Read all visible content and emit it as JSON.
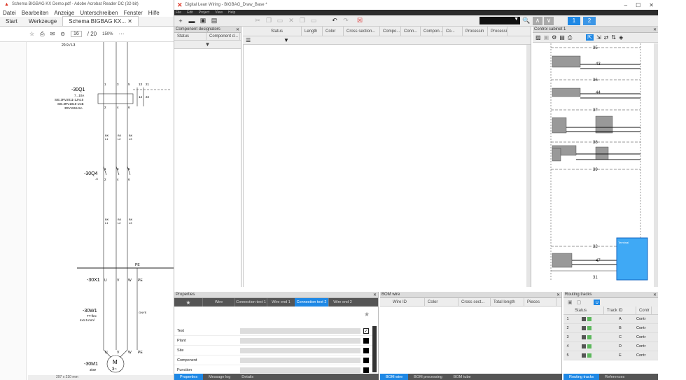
{
  "acrobat": {
    "title": "Schema BIGBAG KX Demo.pdf - Adobe Acrobat Reader DC (32-bit)",
    "menu": [
      "Datei",
      "Bearbeiten",
      "Anzeige",
      "Unterschreiben",
      "Fenster",
      "Hilfe"
    ],
    "tabs": [
      "Start",
      "Werkzeuge",
      "Schema BIGBAG KX..."
    ],
    "page_current": "16",
    "page_total": "/ 20",
    "zoom": "150%",
    "page_size": "297 x 210 mm",
    "schematic": {
      "top_ref": "20.9 / L3",
      "q1_tag": "-30Q1",
      "q1_range": "7...10A",
      "q1_order1": "SIE.3RV2011-1JA15",
      "q1_order2": "SIE.3RV1915-1CB",
      "q1_order3": "3RV1915-5A",
      "q1_pins_top": [
        "1",
        "3",
        "5",
        "13",
        "21"
      ],
      "q1_pins_bot": [
        "2",
        "4",
        "6",
        "14",
        "22"
      ],
      "wire_label": "BK",
      "wire_l1": "L1",
      "wire_l2": "L2",
      "wire_l3": "L3",
      "q4_tag": "-30Q4",
      "q4_sub": ".4",
      "q4_pins_top": [
        "1",
        "3",
        "5"
      ],
      "q4_pins_bot": [
        "2",
        "4",
        "6"
      ],
      "pe": "PE",
      "x1_tag": "-30X1",
      "x1_pins": [
        "U",
        "V",
        "W",
        "PE"
      ],
      "w1_tag": "-30W1",
      "w1_type": "TT-flex",
      "w1_size": "4x1.5 mm²",
      "w1_shield": "GNYE",
      "m1_tag": "-30M1",
      "m1_power": "3kW",
      "m1_letter": "M",
      "m1_phase": "3~",
      "m1_pins": [
        "U",
        "V",
        "W",
        "PE"
      ]
    }
  },
  "dlw": {
    "title": "Digital Lean Wiring - BIGBAG_Draw_Base *",
    "menu": [
      "File",
      "Edit",
      "Project",
      "View",
      "Help"
    ],
    "page_buttons": [
      "1",
      "2"
    ],
    "component_designators": {
      "title": "Component designators",
      "cols": [
        "Status",
        "Component d..."
      ]
    },
    "wire_table": {
      "cols": [
        "Status",
        "Length",
        "Color",
        "Cross section...",
        "Compo...",
        "Conn...",
        "Compon...",
        "Co...",
        "Processin",
        "Processi"
      ]
    },
    "control_cabinet": {
      "title": "Control cabinet 1",
      "rail_labels": [
        "35",
        "43",
        "36",
        "44",
        "37",
        "38",
        "39",
        "32",
        "47",
        "31"
      ],
      "blue_box_title": "Terminal"
    },
    "properties": {
      "title": "Properties",
      "tabs": [
        "Wire",
        "Connection text 1",
        "Wire end 1",
        "Connection text 2",
        "Wire end 2"
      ],
      "active_tab": "Connection text 2",
      "fields": [
        "Text",
        "Plant",
        "Site",
        "Component",
        "Function"
      ],
      "bottom_tabs": [
        "Properties",
        "Message log",
        "Details"
      ]
    },
    "bom_wire": {
      "title": "BOM wire",
      "cols": [
        "Wire ID",
        "Color",
        "Cross sect...",
        "Total length",
        "Pieces"
      ],
      "bottom_tabs": [
        "BOM wire",
        "BOM processing",
        "BOM tube"
      ]
    },
    "routing": {
      "title": "Routing tracks",
      "cols": [
        "Status",
        "Track ID",
        "Contr"
      ],
      "rows": [
        {
          "n": "1",
          "id": "A",
          "c": "Contr"
        },
        {
          "n": "2",
          "id": "B",
          "c": "Contr"
        },
        {
          "n": "3",
          "id": "C",
          "c": "Contr"
        },
        {
          "n": "4",
          "id": "D",
          "c": "Contr"
        },
        {
          "n": "5",
          "id": "E",
          "c": "Contr"
        }
      ],
      "bottom_tabs": [
        "Routing tracks",
        "References"
      ]
    }
  },
  "colors": {
    "accent": "#1e88e5",
    "dark": "#2b2b2b",
    "green": "#5cb85c"
  }
}
